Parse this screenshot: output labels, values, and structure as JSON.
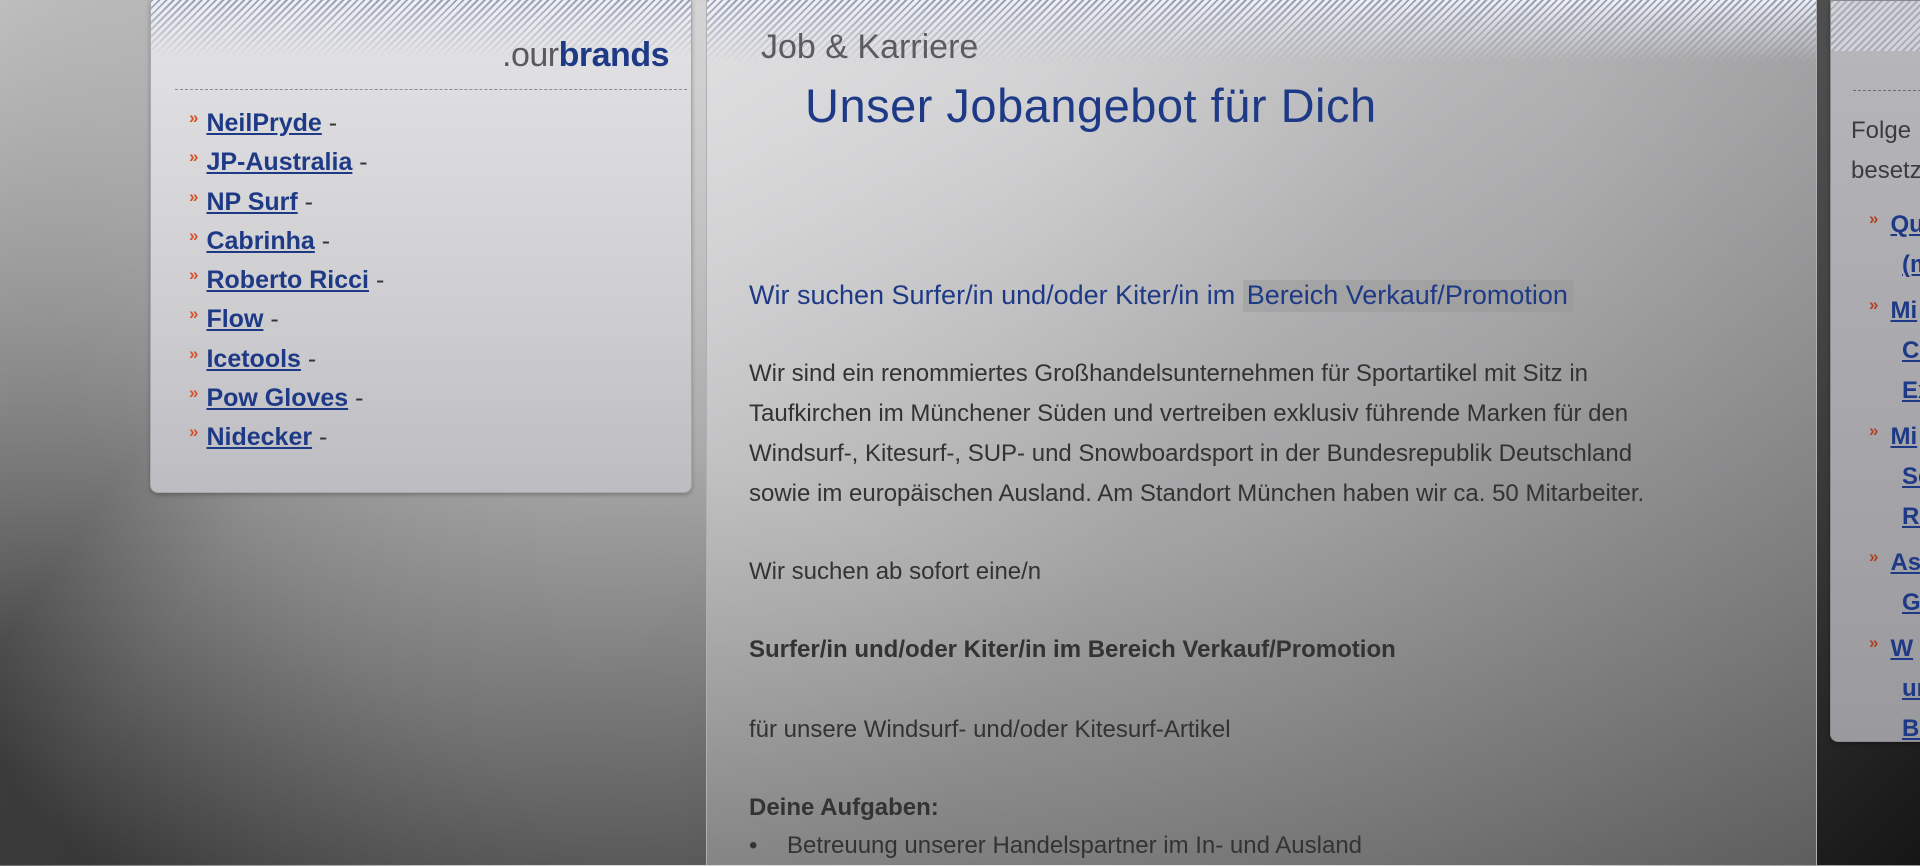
{
  "brands": {
    "title_prefix": ".our",
    "title_bold": "brands",
    "items": [
      {
        "label": "NeilPryde",
        "sep": " -"
      },
      {
        "label": "JP-Australia",
        "sep": " -"
      },
      {
        "label": "NP Surf",
        "sep": " -"
      },
      {
        "label": "Cabrinha",
        "sep": " -"
      },
      {
        "label": "Roberto Ricci",
        "sep": " -"
      },
      {
        "label": "Flow",
        "sep": " -"
      },
      {
        "label": "Icetools",
        "sep": " -"
      },
      {
        "label": "Pow Gloves",
        "sep": " -"
      },
      {
        "label": "Nidecker",
        "sep": " -"
      }
    ],
    "arrow_glyph": "»"
  },
  "main": {
    "section_label": "Job & Karriere",
    "heading": "Unser Jobangebot für Dich",
    "headline_plain": "Wir suchen Surfer/in und/oder Kiter/in im ",
    "headline_highlight": "Bereich Verkauf/Promotion",
    "intro_lines": [
      "Wir sind ein renommiertes Großhandelsunternehmen für Sportartikel mit Sitz in",
      "Taufkirchen im Münchener Süden und vertreiben exklusiv führende Marken für den",
      "Windsurf-, Kitesurf-, SUP- und Snowboardsport in der Bundesrepublik Deutschland",
      "sowie im europäischen Ausland. Am Standort München haben wir ca. 50 Mitarbeiter."
    ],
    "seeking": "Wir suchen ab sofort eine/n",
    "role": "Surfer/in und/oder Kiter/in im Bereich Verkauf/Promotion",
    "for_articles": "für unsere Windsurf- und/oder Kitesurf-Artikel",
    "tasks_heading": "Deine Aufgaben:",
    "task_bullet": "•",
    "tasks": [
      "Betreuung unserer Handelspartner im In- und Ausland"
    ]
  },
  "right": {
    "intro_lines": [
      "Folge",
      "besetz"
    ],
    "items": [
      {
        "lines": [
          "Qu",
          "(m"
        ]
      },
      {
        "lines": [
          "Mi",
          "Cu",
          "Ex"
        ]
      },
      {
        "lines": [
          "Mi",
          "Se",
          "Re"
        ]
      },
      {
        "lines": [
          "As",
          "Ge"
        ]
      },
      {
        "lines": [
          "W",
          "ur",
          "Be"
        ]
      }
    ]
  },
  "colors": {
    "link": "#1e3a86",
    "arrow": "#d8502a",
    "text": "#333333"
  }
}
